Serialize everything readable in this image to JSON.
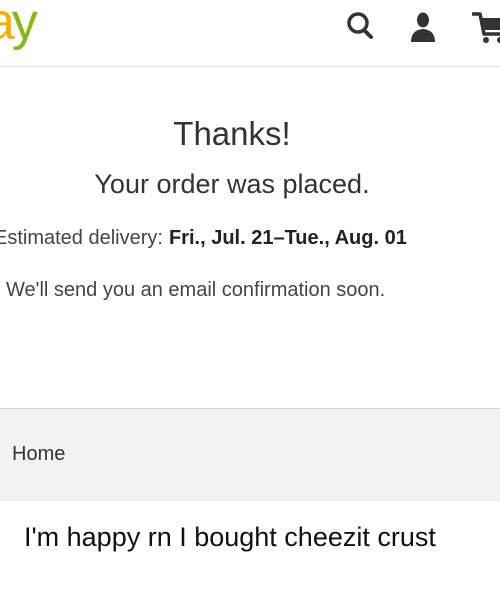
{
  "header": {
    "logo_a": "a",
    "logo_y": "y",
    "icons": [
      "search-icon",
      "user-icon",
      "cart-icon"
    ],
    "colors": {
      "logo_a": "#f5af02",
      "logo_y": "#86b817",
      "icon": "#333333"
    }
  },
  "confirmation": {
    "title": "Thanks!",
    "message": "Your order was placed.",
    "delivery_label": "Estimated delivery:",
    "delivery_dates": "Fri., Jul. 21–Tue., Aug. 01",
    "email_note": "We'll send you an email confirmation soon."
  },
  "footer": {
    "home_label": "Home"
  },
  "caption": {
    "text": "I'm happy rn I bought cheezit crust"
  }
}
